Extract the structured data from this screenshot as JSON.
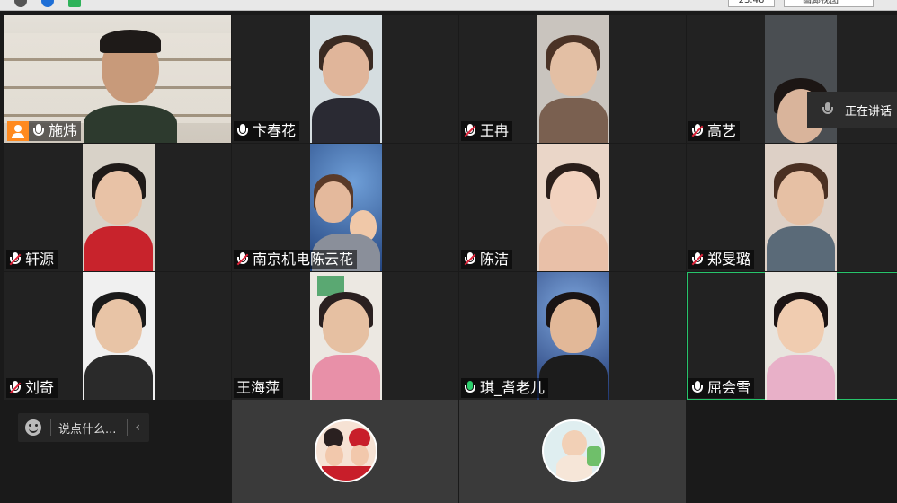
{
  "topbar": {
    "clock": "23:46",
    "view_label": "画廊视图"
  },
  "speaking_indicator": "正在讲话",
  "chat": {
    "placeholder": "说点什么..."
  },
  "participants": [
    {
      "name": "施炜",
      "mic": "on",
      "host": true
    },
    {
      "name": "卞春花",
      "mic": "on"
    },
    {
      "name": "王冉",
      "mic": "muted"
    },
    {
      "name": "高艺",
      "mic": "muted"
    },
    {
      "name": "轩源",
      "mic": "muted"
    },
    {
      "name": "南京机电陈云花",
      "mic": "muted"
    },
    {
      "name": "陈洁",
      "mic": "muted"
    },
    {
      "name": "郑旻璐",
      "mic": "muted"
    },
    {
      "name": "刘奇",
      "mic": "muted"
    },
    {
      "name": "王海萍",
      "mic": "none"
    },
    {
      "name": "琪_耆老儿",
      "mic": "active"
    },
    {
      "name": "屈会雪",
      "mic": "on"
    }
  ],
  "colors": {
    "accent_active": "#27c46b",
    "muted_red": "#e0243a",
    "host_badge": "#ff8a1f"
  }
}
